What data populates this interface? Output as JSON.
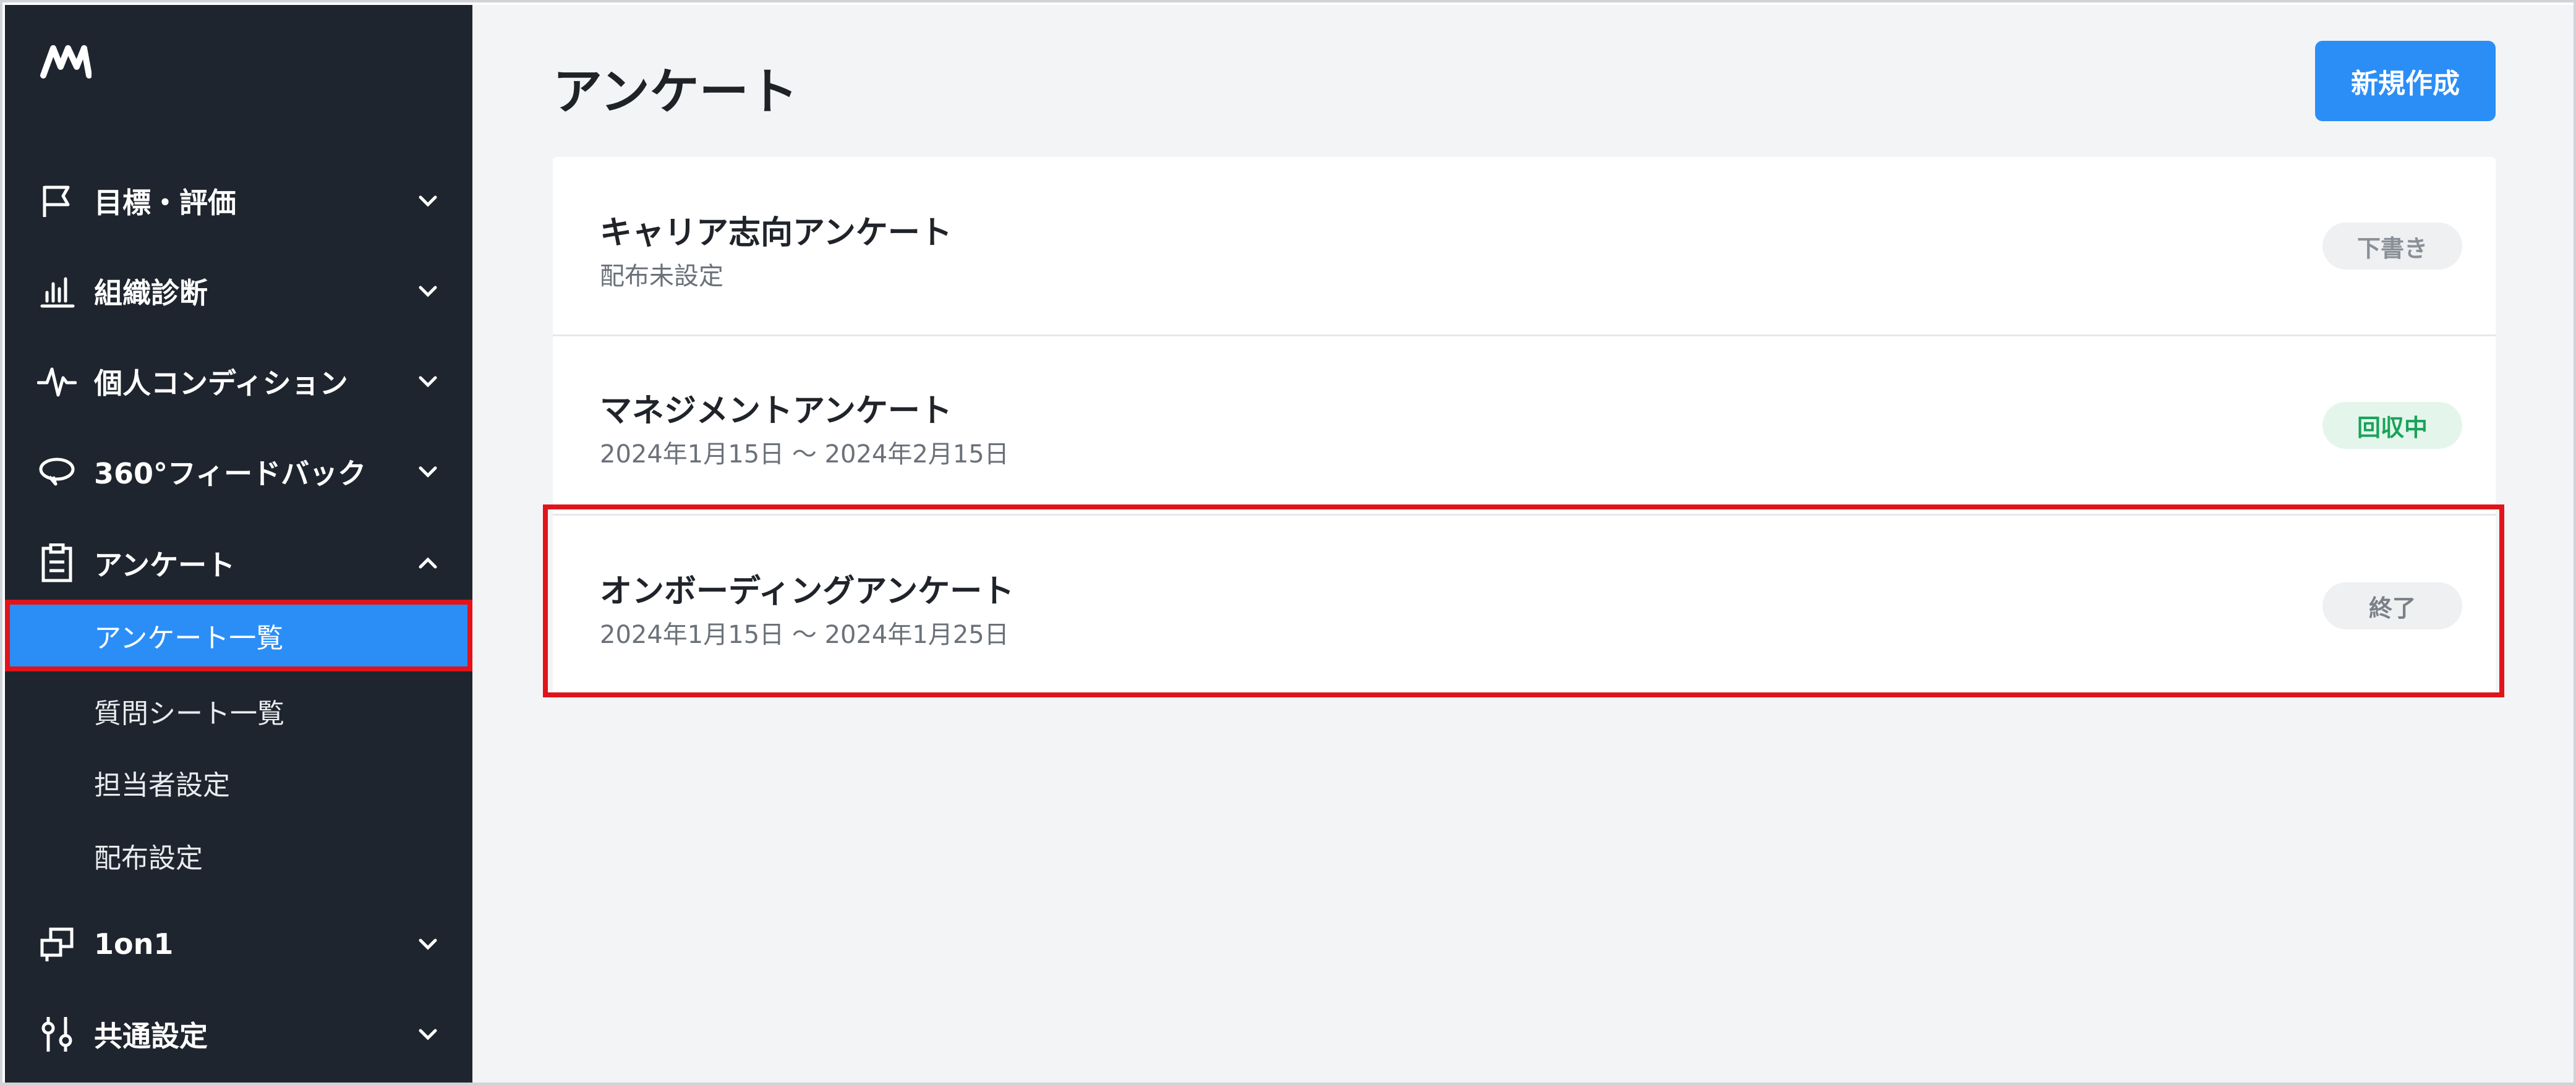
{
  "sidebar": {
    "logo_text": "ʍ",
    "items": [
      {
        "label": "目標・評価",
        "icon": "flag-icon"
      },
      {
        "label": "組織診断",
        "icon": "bar-chart-icon"
      },
      {
        "label": "個人コンディション",
        "icon": "pulse-icon"
      },
      {
        "label": "360°フィードバック",
        "icon": "feedback-loop-icon"
      },
      {
        "label": "アンケート",
        "icon": "clipboard-icon"
      },
      {
        "label": "1on1",
        "icon": "chat-windows-icon"
      },
      {
        "label": "共通設定",
        "icon": "sliders-icon"
      }
    ],
    "sub_items": [
      {
        "label": "アンケート一覧"
      },
      {
        "label": "質問シート一覧"
      },
      {
        "label": "担当者設定"
      },
      {
        "label": "配布設定"
      }
    ]
  },
  "main": {
    "title": "アンケート",
    "new_button": "新規作成",
    "surveys": [
      {
        "title": "キャリア志向アンケート",
        "subtitle": "配布未設定",
        "status": "下書き"
      },
      {
        "title": "マネジメントアンケート",
        "subtitle": "2024年1月15日 〜 2024年2月15日",
        "status": "回収中"
      },
      {
        "title": "オンボーディングアンケート",
        "subtitle": "2024年1月15日 〜 2024年1月25日",
        "status": "終了"
      }
    ]
  },
  "colors": {
    "sidebar_bg": "#1f252e",
    "accent": "#2b8ef7",
    "highlight": "#e0141a",
    "status_active": "#18a35a"
  }
}
